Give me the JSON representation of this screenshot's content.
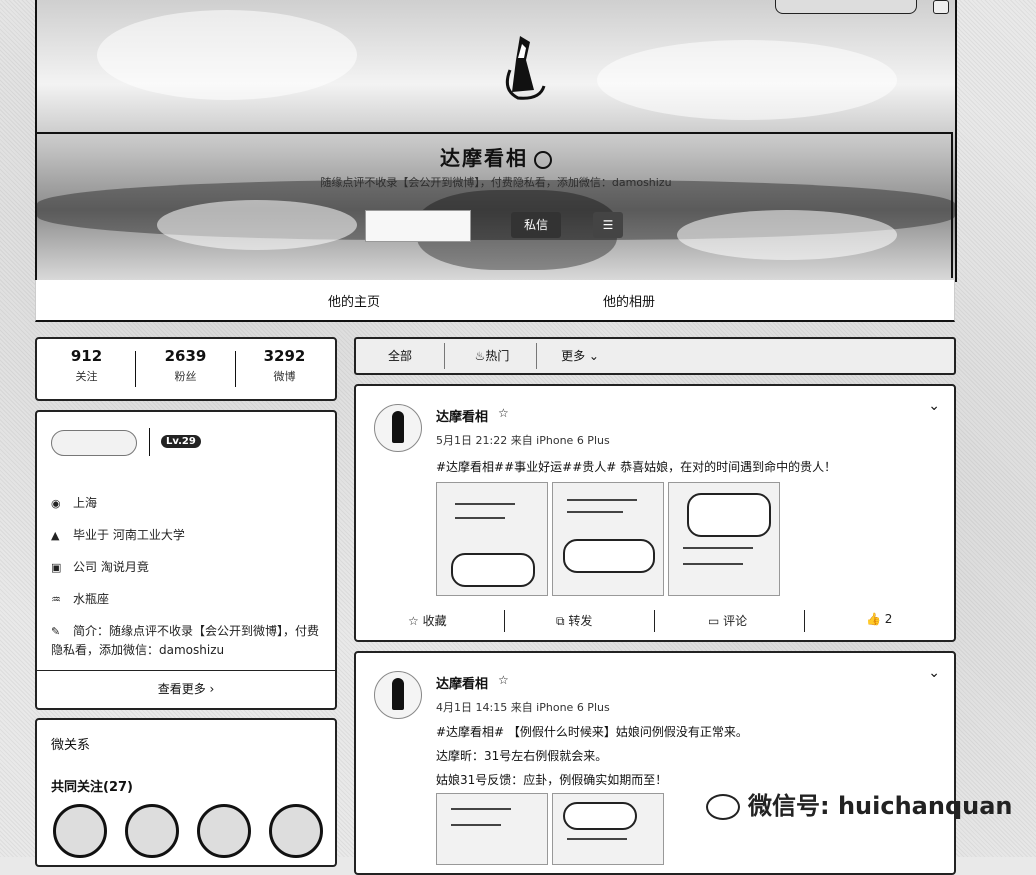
{
  "profile": {
    "name": "达摩看相",
    "bio": "随缘点评不收录【会公开到微博】，付费隐私看，添加微信：damoshizu",
    "message_label": "私信",
    "more_label": "☰"
  },
  "tabs": {
    "home": "他的主页",
    "album": "他的相册"
  },
  "stats": [
    {
      "value": "912",
      "label": "关注"
    },
    {
      "value": "2639",
      "label": "粉丝"
    },
    {
      "value": "3292",
      "label": "微博"
    }
  ],
  "info": {
    "level_badge": "Lv.29",
    "location": "上海",
    "school": "毕业于 河南工业大学",
    "company": "公司 淘说月竟",
    "constellation": "水瓶座",
    "intro": "简介：随缘点评不收录【会公开到微博】，付费隐私看，添加微信：damoshizu",
    "see_more": "查看更多 ›"
  },
  "relations": {
    "title": "微关系",
    "common": "共同关注(27)"
  },
  "filter": {
    "all": "全部",
    "hot": "热门",
    "more": "更多 ⌄"
  },
  "posts": [
    {
      "author": "达摩看相",
      "meta": "5月1日 21:22 来自 iPhone 6 Plus",
      "lines": [
        "#达摩看相##事业好运##贵人# 恭喜姑娘，在对的时间遇到命中的贵人！"
      ],
      "actions": {
        "collect": "收藏",
        "repost": "转发",
        "comment": "评论",
        "like": "2"
      }
    },
    {
      "author": "达摩看相",
      "meta": "4月1日 14:15 来自 iPhone 6 Plus",
      "lines": [
        "#达摩看相# 【例假什么时候来】姑娘问例假没有正常来。",
        "达摩昕：31号左右例假就会来。",
        "姑娘31号反馈：应卦，例假确实如期而至！"
      ]
    }
  ],
  "watermark": "微信号: huichanquan"
}
